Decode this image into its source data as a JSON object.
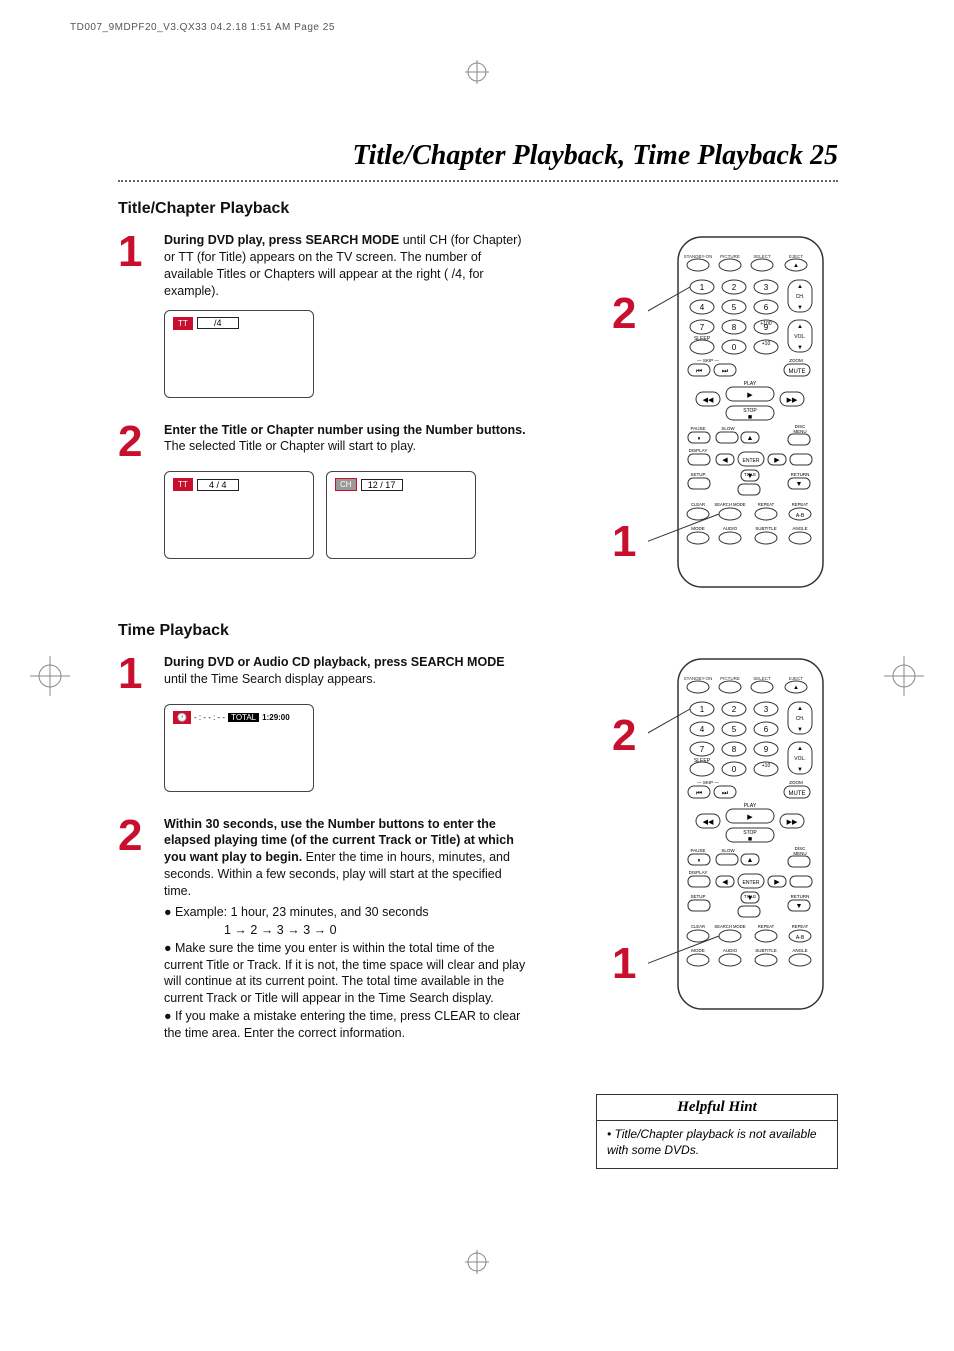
{
  "header": {
    "pageinfo": "TD007_9MDPF20_V3.QX33   04.2.18   1:51 AM   Page 25"
  },
  "title": "Title/Chapter Playback, Time Playback  25",
  "section1": {
    "heading": "Title/Chapter Playback",
    "step1": {
      "num": "1",
      "bold": "During DVD play, press SEARCH MODE",
      "rest": " until CH (for Chapter) or TT (for Title) appears on the TV screen.  The number of available Titles or Chapters will appear at the right (   /4, for example).",
      "osd_badge": "TT",
      "osd_field": "  /4"
    },
    "step2": {
      "num": "2",
      "bold": "Enter the Title or Chapter number using the Number buttons.",
      "rest": "  The selected Title or Chapter will start to play.",
      "osd1_badge": "TT",
      "osd1_field": "4 / 4",
      "osd2_badge": "CH",
      "osd2_field": "12 / 17"
    },
    "remote_call_top": "2",
    "remote_call_bottom": "1"
  },
  "section2": {
    "heading": "Time Playback",
    "step1": {
      "num": "1",
      "bold": "During DVD or Audio CD playback, press SEARCH MODE",
      "rest": " until the Time Search display appears.",
      "osd_clock": "🕐",
      "osd_time_blank": "- : - - : - -",
      "osd_total_label": "TOTAL",
      "osd_total": "1:29:00"
    },
    "step2": {
      "num": "2",
      "bold": "Within 30 seconds, use the Number buttons to enter the elapsed playing time (of the current Track or Title) at which you want play to begin.",
      "rest": "  Enter the time in hours, minutes, and seconds.  Within a few seconds, play will start at the specified time.",
      "bullet1a": "● Example: 1 hour, 23 minutes, and 30 seconds",
      "bullet1b": "1 → 2 → 3 → 3 → 0",
      "bullet2": "● Make sure the time you enter is within the total time of the current Title or Track.  If it is not, the time space will clear and play will continue at its current point.  The total time available in the current Track or Title will appear in the Time Search display.",
      "bullet3": "● If you make a mistake entering the time, press CLEAR to clear the time area.  Enter the correct information."
    },
    "remote_call_top": "2",
    "remote_call_bottom": "1"
  },
  "hint": {
    "title": "Helpful Hint",
    "body": "• Title/Chapter playback is not available with some DVDs."
  },
  "remote_labels": {
    "row0": [
      "STANDBY-ON",
      "PICTURE",
      "SELECT",
      "EJECT"
    ],
    "nums": [
      "1",
      "2",
      "3",
      "4",
      "5",
      "6",
      "7",
      "8",
      "9",
      "0"
    ],
    "ch": "CH.",
    "vol": "VOL.",
    "sleep": "SLEEP",
    "p100": "+100",
    "p10": "+10",
    "skip": "SKIP",
    "zoom": "ZOOM",
    "mute": "MUTE",
    "play": "PLAY",
    "stop": "STOP",
    "pause": "PAUSE",
    "slow": "SLOW",
    "disc_menu": "DISC MENU",
    "display": "DISPLAY",
    "enter": "ENTER",
    "setup": "SETUP",
    "title_b": "TITLE",
    "return": "RETURN",
    "clear": "CLEAR",
    "search": "SEARCH MODE",
    "repeat": "REPEAT",
    "ab": "A-B",
    "mode": "MODE",
    "audio": "AUDIO",
    "subtitle": "SUBTITLE",
    "angle": "ANGLE"
  }
}
